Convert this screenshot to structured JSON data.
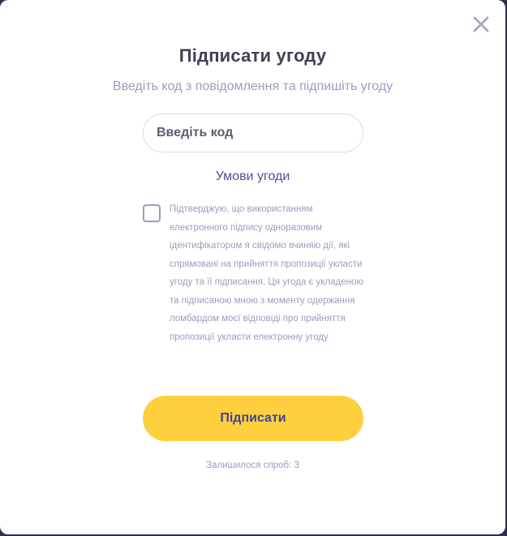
{
  "modal": {
    "close_icon": "close-icon",
    "title": "Підписати угоду",
    "subtitle": "Введіть код з повідомлення та підпишіть угоду",
    "code_input": {
      "placeholder": "Введіть код",
      "value": ""
    },
    "terms_link": "Умови угоди",
    "consent": {
      "checked": false,
      "text": "Підтверджую, що використанням електронного підпису одноразовим ідентифікатором я свідомо вчиняю дії, які спрямовані на прийняття пропозиції укласти угоду та її підписання. Ця угода є укладеною та підписаною мною з моменту одержання ломбардом моєї відповіді про прийняття пропозиції укласти електронну угоду"
    },
    "sign_button": "Підписати",
    "attempts_text": "Залишилося спроб: 3"
  },
  "colors": {
    "overlay": "#2e2f4d",
    "title": "#3f4156",
    "muted": "#9a9cc0",
    "link": "#4c5096",
    "button_bg": "#ffd03e",
    "button_text": "#3d4497"
  }
}
